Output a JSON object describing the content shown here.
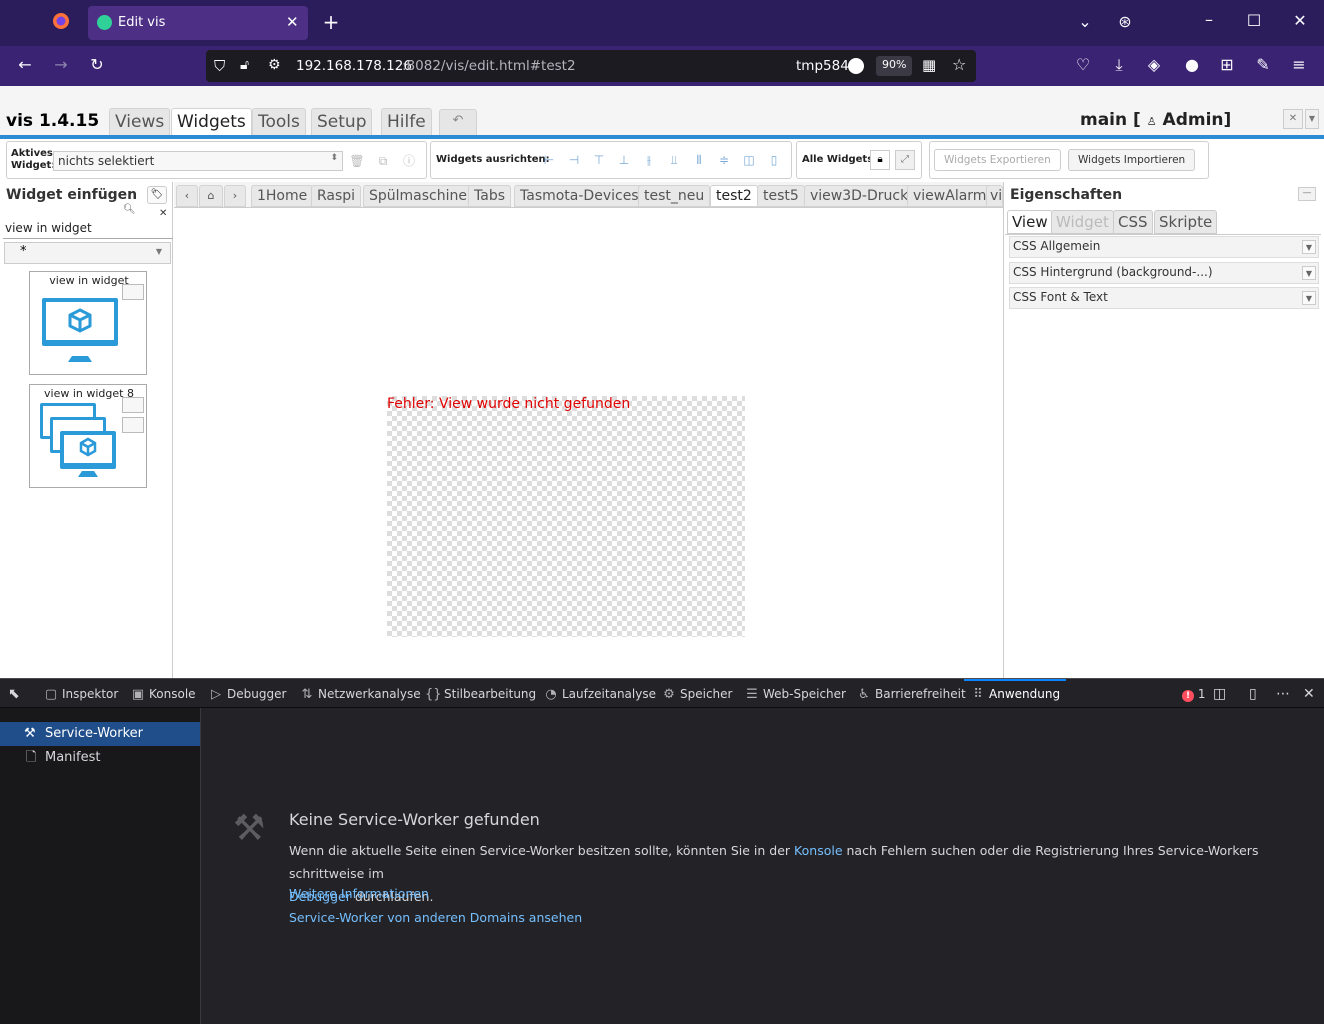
{
  "browser": {
    "tab_title": "Edit vis",
    "new_tab_icon": "plus-icon",
    "url": "192.168.178.126:8082/vis/edit.html#test2",
    "url_host": "192.168.178.126",
    "url_rest": ":8082/vis/edit.html#test2",
    "profile_label": "tmp584",
    "zoom": "90%"
  },
  "vis": {
    "version": "vis 1.4.15",
    "menu": [
      "Views",
      "Widgets",
      "Tools",
      "Setup",
      "Hilfe"
    ],
    "active_menu": "Widgets",
    "view_title": "main [",
    "user": "Admin]"
  },
  "toolbar": {
    "active_widget_label_1": "Aktives",
    "active_widget_label_2": "Widget:",
    "active_widget_value": "nichts selektiert",
    "align_label": "Widgets ausrichten:",
    "all_widgets_label": "Alle Widgets:",
    "export_label": "Widgets Exportieren",
    "import_label": "Widgets Importieren"
  },
  "left_panel": {
    "title": "Widget einfügen",
    "filter_value": "view in widget",
    "set_select": "*",
    "items": [
      {
        "title": "view in widget"
      },
      {
        "title": "view in widget 8"
      }
    ]
  },
  "view_tabs": [
    "1Home",
    "Raspi",
    "Spülmaschine",
    "Tabs",
    "Tasmota-Devices",
    "test_neu",
    "test2",
    "test5",
    "view3D-Druck",
    "viewAlarm",
    "vi"
  ],
  "active_view": "test2",
  "canvas": {
    "error_text": "Fehler: View wurde nicht gefunden"
  },
  "properties": {
    "title": "Eigenschaften",
    "tabs": [
      "View",
      "Widget",
      "CSS",
      "Skripte"
    ],
    "sections": [
      "CSS Allgemein",
      "CSS Hintergrund (background-...)",
      "CSS Font & Text"
    ]
  },
  "devtools": {
    "tabs": [
      {
        "label": "Inspektor",
        "icon": "inspector-icon"
      },
      {
        "label": "Konsole",
        "icon": "console-icon"
      },
      {
        "label": "Debugger",
        "icon": "debugger-icon"
      },
      {
        "label": "Netzwerkanalyse",
        "icon": "network-icon"
      },
      {
        "label": "Stilbearbeitung",
        "icon": "style-editor-icon"
      },
      {
        "label": "Laufzeitanalyse",
        "icon": "performance-icon"
      },
      {
        "label": "Speicher",
        "icon": "memory-icon"
      },
      {
        "label": "Web-Speicher",
        "icon": "storage-icon"
      },
      {
        "label": "Barrierefreiheit",
        "icon": "accessibility-icon"
      },
      {
        "label": "Anwendung",
        "icon": "application-icon"
      }
    ],
    "error_count": "1",
    "sidebar": [
      "Service-Worker",
      "Manifest"
    ],
    "main": {
      "heading": "Keine Service-Worker gefunden",
      "text_1": "Wenn die aktuelle Seite einen Service-Worker besitzen sollte, könnten Sie in der",
      "link_console": "Konsole",
      "text_2": "nach Fehlern suchen oder die Registrierung Ihres Service-Workers schrittweise im",
      "link_debugger": "Debugger",
      "text_3": "durchlaufen.",
      "link_more": "Weitere Informationen",
      "link_other": "Service-Worker von anderen Domains ansehen"
    }
  },
  "colors": {
    "chrome_dark": "#2b1d5c",
    "vis_accent": "#2c8bd3",
    "error_red": "#e00000",
    "devtools_active": "#204e8a"
  }
}
